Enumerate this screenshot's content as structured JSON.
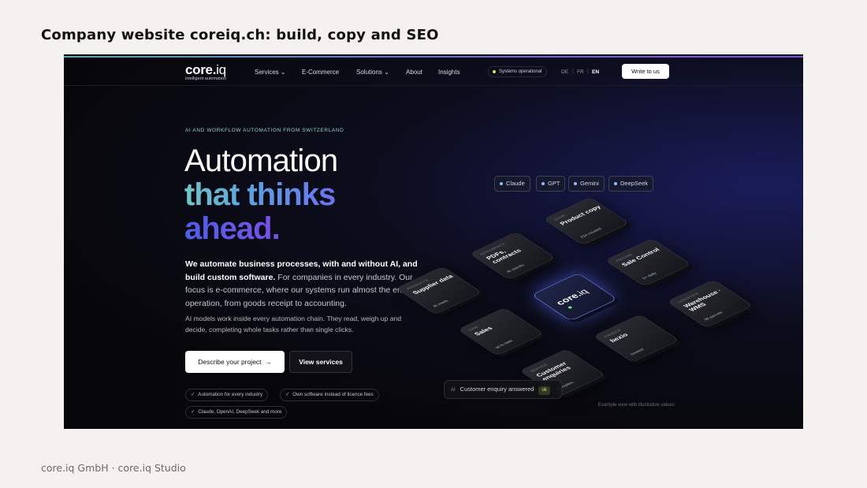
{
  "slide": {
    "title": "Company website coreiq.ch: build, copy and SEO",
    "footer": "core.iq GmbH · core.iq Studio"
  },
  "nav": {
    "logo_main": "core.",
    "logo_iq": "iq",
    "logo_sub": "intelligent automation",
    "items": [
      {
        "label": "Services",
        "chevron": true
      },
      {
        "label": "E-Commerce",
        "chevron": false
      },
      {
        "label": "Solutions",
        "chevron": true
      },
      {
        "label": "About",
        "chevron": false
      },
      {
        "label": "Insights",
        "chevron": false
      }
    ],
    "status": "Systems operational",
    "langs": [
      "DE",
      "FR",
      "EN"
    ],
    "active_lang": "EN",
    "cta": "Write to us"
  },
  "hero": {
    "eyebrow": "AI AND WORKFLOW AUTOMATION FROM SWITZERLAND",
    "line1": "Automation",
    "line2": "that thinks",
    "line3": "ahead.",
    "lead_bold": "We automate business processes, with and without AI, and build custom software.",
    "lead_rest": " For companies in every industry. Our focus is e-commerce, where our systems run almost the entire operation, from goods receipt to accounting.",
    "sub": "AI models work inside every automation chain. They read, weigh up and decide, completing whole tasks rather than single clicks.",
    "btn_primary": "Describe your project",
    "btn_primary_arrow": "→",
    "btn_secondary": "View services",
    "chips": [
      "Automation for every industry",
      "Own software instead of licence fees",
      "Claude, OpenAI, DeepSeek and more"
    ]
  },
  "visual": {
    "models": [
      "Claude",
      "GPT",
      "Gemini",
      "DeepSeek"
    ],
    "center_logo_main": "core.",
    "center_logo_iq": "iq",
    "tiles": [
      {
        "category": "PRODUCTS",
        "name": "Supplier data",
        "status": "AI reads"
      },
      {
        "category": "DOCUMENTS",
        "name": "PDFs, contracts",
        "status": "AI checks"
      },
      {
        "category": "SHOP",
        "name": "Product copy",
        "status": "214 created"
      },
      {
        "category": "CRM",
        "name": "Sales",
        "status": "up to date"
      },
      {
        "category": "FINANCE",
        "name": "bexio",
        "status": "booked"
      },
      {
        "category": "PRICING",
        "name": "Sale Control",
        "status": "2× daily"
      },
      {
        "category": "SERVICE",
        "name": "Customer enquiries",
        "status": "AI replies"
      },
      {
        "category": "LOGISTICS",
        "name": "Warehouse · WMS",
        "status": "36 parcels"
      }
    ],
    "notify_ai": "AI",
    "notify_text": "Customer enquiry answered",
    "notify_ok": "ok",
    "caption": "Example view with illustrative values"
  }
}
